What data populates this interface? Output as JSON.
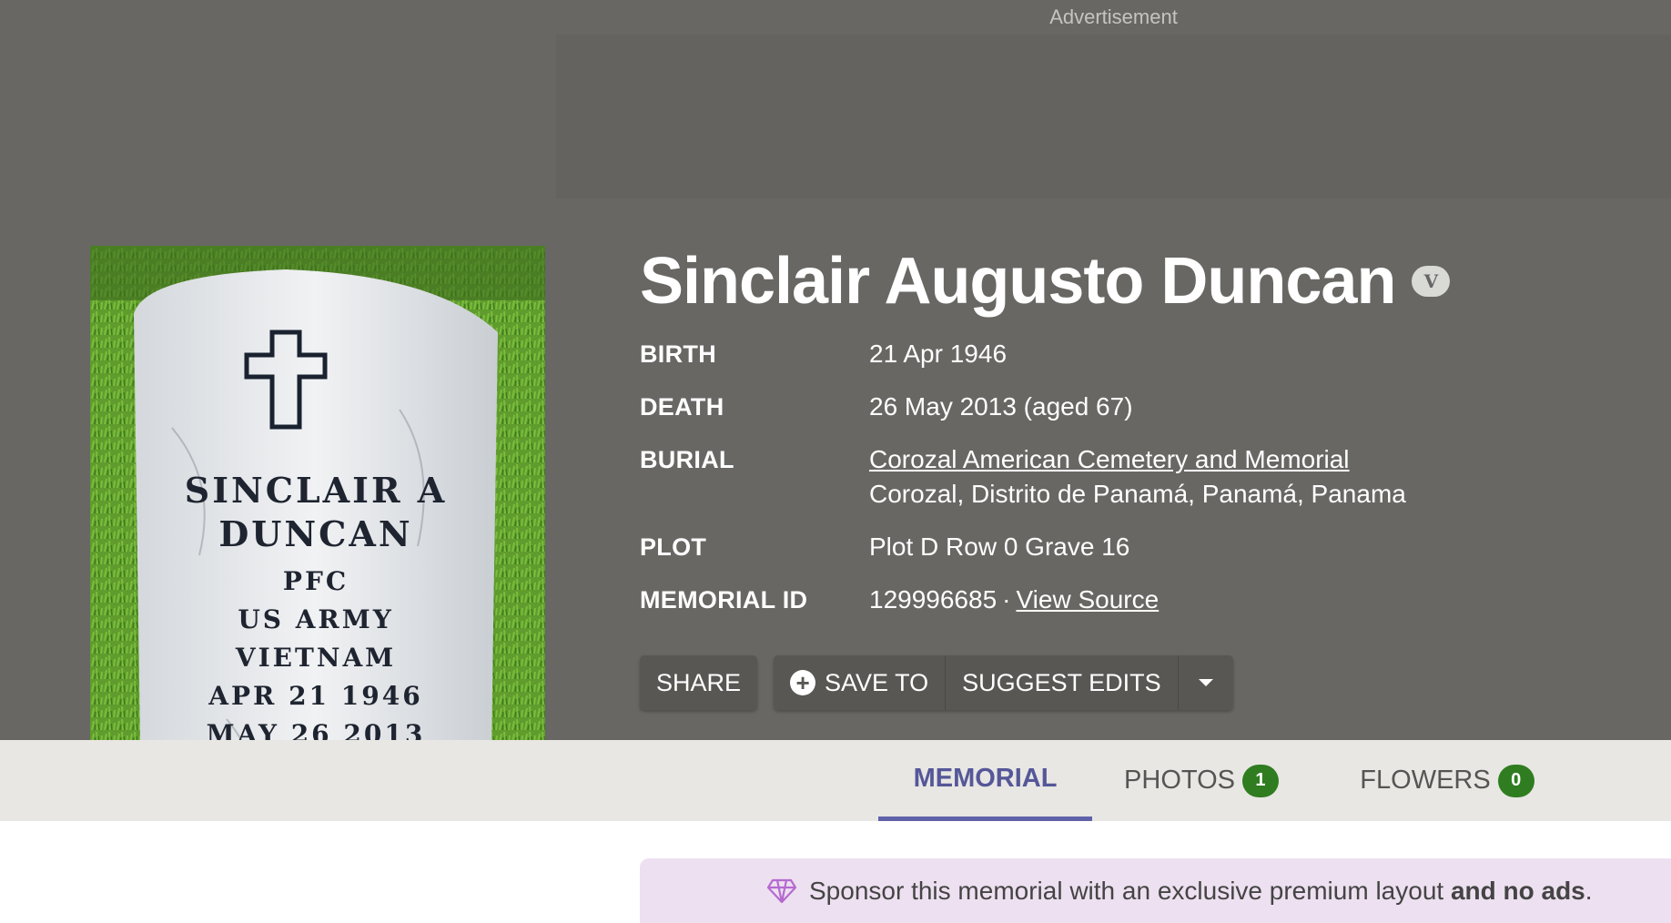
{
  "ad": {
    "label": "Advertisement"
  },
  "headstone": {
    "lines": [
      "SINCLAIR A",
      "DUNCAN",
      "PFC",
      "US ARMY",
      "VIETNAM",
      "APR 21 1946",
      "MAY 26 2013"
    ]
  },
  "memorial": {
    "name": "Sinclair Augusto Duncan",
    "veteran_badge": "V"
  },
  "facts": {
    "birth_label": "BIRTH",
    "birth_value": "21 Apr 1946",
    "death_label": "DEATH",
    "death_value": "26 May 2013 (aged 67)",
    "burial_label": "BURIAL",
    "burial_link": "Corozal American Cemetery and Memorial",
    "burial_location": "Corozal, Distrito de Panamá, Panamá, Panama",
    "plot_label": "PLOT",
    "plot_value": "Plot D Row 0 Grave 16",
    "id_label": "MEMORIAL ID",
    "id_value": "129996685",
    "id_separator": "·",
    "view_source": "View Source"
  },
  "actions": {
    "share": "SHARE",
    "save_to": "SAVE TO",
    "suggest_edits": "SUGGEST EDITS"
  },
  "tabs": [
    {
      "label": "MEMORIAL",
      "active": true
    },
    {
      "label": "PHOTOS",
      "count": "1"
    },
    {
      "label": "FLOWERS",
      "count": "0"
    }
  ],
  "sponsor": {
    "text": "Sponsor this memorial with an exclusive premium layout ",
    "bold": "and no ads",
    "end": "."
  },
  "icons": [
    "veteran-badge",
    "plus-circle-icon",
    "chevron-down-icon",
    "diamond-icon"
  ],
  "colors": {
    "header_bg": "#686764",
    "tab_active": "#5f62a8",
    "badge_green": "#2f7d20",
    "sponsor_bg": "#ede0f0"
  }
}
